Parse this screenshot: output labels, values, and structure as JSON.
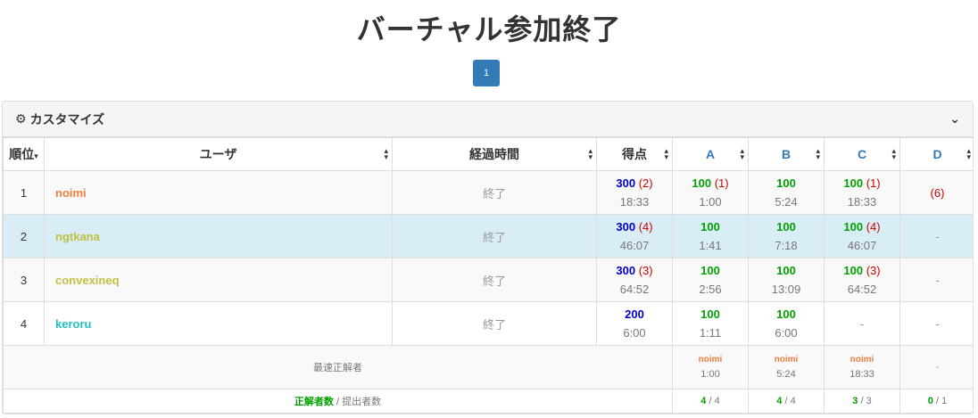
{
  "page": {
    "title": "バーチャル参加終了"
  },
  "pagination": {
    "current": "1"
  },
  "panel": {
    "title": "カスタマイズ",
    "icon": "gear-icon",
    "toggle_icon": "chevron-down-icon"
  },
  "table": {
    "headers": {
      "rank": "順位",
      "rank_sort": "▾",
      "user": "ユーザ",
      "elapsed": "経過時間",
      "score": "得点",
      "problems": [
        "A",
        "B",
        "C",
        "D"
      ]
    },
    "rows": [
      {
        "rank": "1",
        "user": "noimi",
        "user_color": "#f08040",
        "elapsed": "終了",
        "total": {
          "score": "300",
          "pen": "(2)",
          "time": "18:33"
        },
        "problems": [
          {
            "score": "100",
            "pen": "(1)",
            "time": "1:00"
          },
          {
            "score": "100",
            "pen": "",
            "time": "5:24"
          },
          {
            "score": "100",
            "pen": "(1)",
            "time": "18:33"
          },
          {
            "score": "",
            "pen": "(6)",
            "time": ""
          }
        ]
      },
      {
        "rank": "2",
        "user": "ngtkana",
        "user_color": "#c0c040",
        "elapsed": "終了",
        "total": {
          "score": "300",
          "pen": "(4)",
          "time": "46:07"
        },
        "problems": [
          {
            "score": "100",
            "pen": "",
            "time": "1:41"
          },
          {
            "score": "100",
            "pen": "",
            "time": "7:18"
          },
          {
            "score": "100",
            "pen": "(4)",
            "time": "46:07"
          },
          {
            "dash": "-"
          }
        ]
      },
      {
        "rank": "3",
        "user": "convexineq",
        "user_color": "#c0c040",
        "elapsed": "終了",
        "total": {
          "score": "300",
          "pen": "(3)",
          "time": "64:52"
        },
        "problems": [
          {
            "score": "100",
            "pen": "",
            "time": "2:56"
          },
          {
            "score": "100",
            "pen": "",
            "time": "13:09"
          },
          {
            "score": "100",
            "pen": "(3)",
            "time": "64:52"
          },
          {
            "dash": "-"
          }
        ]
      },
      {
        "rank": "4",
        "user": "keroru",
        "user_color": "#20c0c0",
        "elapsed": "終了",
        "total": {
          "score": "200",
          "pen": "",
          "time": "6:00"
        },
        "problems": [
          {
            "score": "100",
            "pen": "",
            "time": "1:11"
          },
          {
            "score": "100",
            "pen": "",
            "time": "6:00"
          },
          {
            "dash": "-"
          },
          {
            "dash": "-"
          }
        ]
      }
    ],
    "fastest": {
      "label": "最速正解者",
      "cells": [
        {
          "name": "noimi",
          "time": "1:00"
        },
        {
          "name": "noimi",
          "time": "5:24"
        },
        {
          "name": "noimi",
          "time": "18:33"
        },
        {
          "dash": "-"
        }
      ]
    },
    "stats": {
      "label_solved": "正解者数",
      "label_sep": " / ",
      "label_submitted": "提出者数",
      "cells": [
        {
          "solved": "4",
          "sep": " / ",
          "submitted": "4"
        },
        {
          "solved": "4",
          "sep": " / ",
          "submitted": "4"
        },
        {
          "solved": "3",
          "sep": " / ",
          "submitted": "3"
        },
        {
          "solved": "0",
          "sep": " / ",
          "submitted": "1"
        }
      ]
    }
  }
}
